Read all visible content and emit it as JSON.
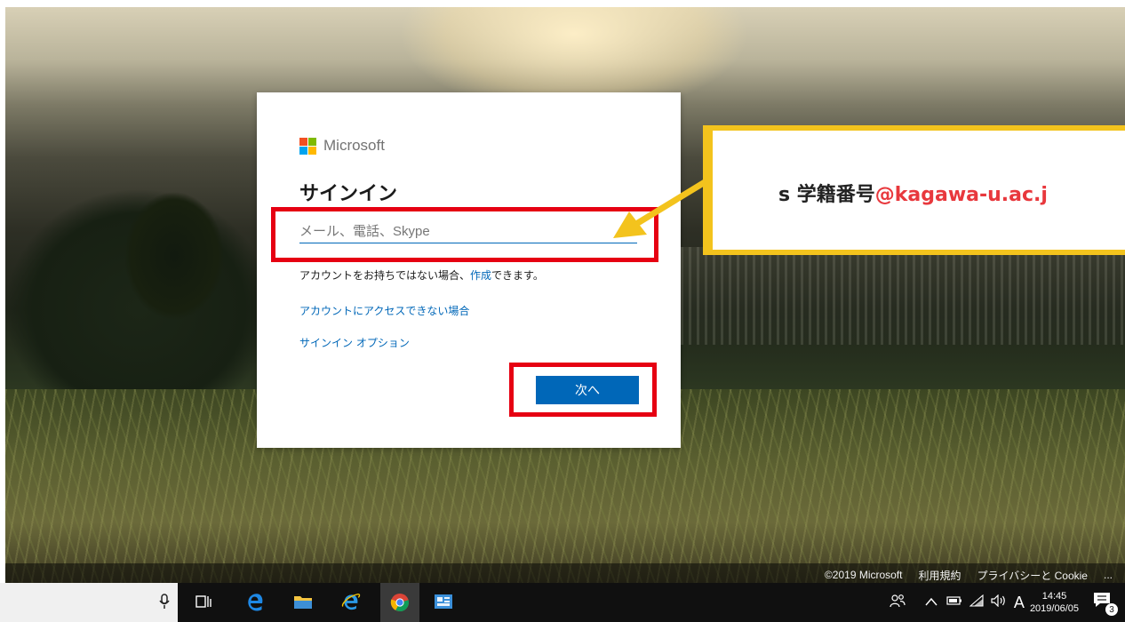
{
  "signin": {
    "brand": "Microsoft",
    "heading": "サインイン",
    "email_placeholder": "メール、電話、Skype",
    "no_account_prefix": "アカウントをお持ちではない場合、",
    "no_account_link": "作成",
    "no_account_suffix": "できます。",
    "cant_access": "アカウントにアクセスできない場合",
    "signin_options": "サインイン オプション",
    "next_button": "次へ"
  },
  "annotation": {
    "prefix": "s 学籍番号",
    "domain": "@kagawa-u.ac.j"
  },
  "footer": {
    "copyright": "©2019 Microsoft",
    "terms": "利用規約",
    "privacy": "プライバシーと Cookie",
    "more": "..."
  },
  "taskbar": {
    "ime_indicator": "A",
    "time": "14:45",
    "date": "2019/06/05",
    "notification_count": "3",
    "icons": [
      "microphone-icon",
      "task-view-icon",
      "edge-icon",
      "file-explorer-icon",
      "internet-explorer-icon",
      "chrome-icon",
      "app-icon"
    ]
  },
  "colors": {
    "accent": "#0067b8",
    "highlight_red": "#e60012",
    "callout_yellow": "#f3c31d",
    "domain_red": "#e8383d"
  }
}
